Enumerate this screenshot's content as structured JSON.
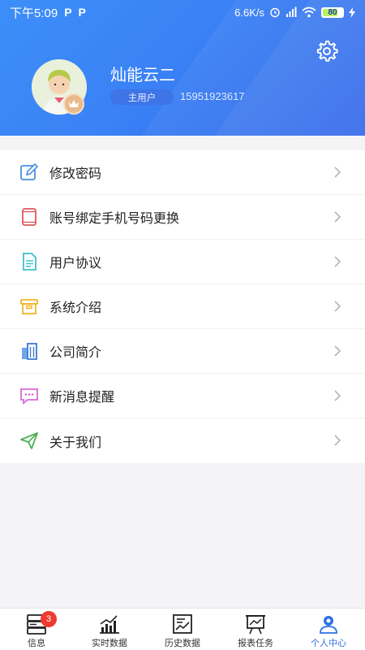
{
  "status_bar": {
    "time": "下午5:09",
    "p_icons": [
      "P",
      "P"
    ],
    "network_speed": "6.6K/s",
    "battery": "80"
  },
  "profile": {
    "username": "灿能云二",
    "role": "主用户",
    "phone": "15951923617"
  },
  "menu": {
    "items": [
      {
        "label": "修改密码",
        "icon": "edit-icon",
        "color": "#4a8fe0"
      },
      {
        "label": "账号绑定手机号码更换",
        "icon": "tablet-icon",
        "color": "#e0575b"
      },
      {
        "label": "用户协议",
        "icon": "document-icon",
        "color": "#3fc0c9"
      },
      {
        "label": "系统介绍",
        "icon": "box-icon",
        "color": "#f0b429"
      },
      {
        "label": "公司简介",
        "icon": "building-icon",
        "color": "#3a7bd5"
      },
      {
        "label": "新消息提醒",
        "icon": "message-icon",
        "color": "#d86ad8"
      },
      {
        "label": "关于我们",
        "icon": "send-icon",
        "color": "#4caf50"
      }
    ]
  },
  "tabbar": {
    "tabs": [
      {
        "label": "信息",
        "badge": "3"
      },
      {
        "label": "实时数据"
      },
      {
        "label": "历史数据"
      },
      {
        "label": "报表任务"
      },
      {
        "label": "个人中心",
        "active": true
      }
    ]
  },
  "colors": {
    "header_blue": "#3a82f6",
    "active_tab": "#2f6fe6",
    "badge_red": "#ef3a2f"
  }
}
